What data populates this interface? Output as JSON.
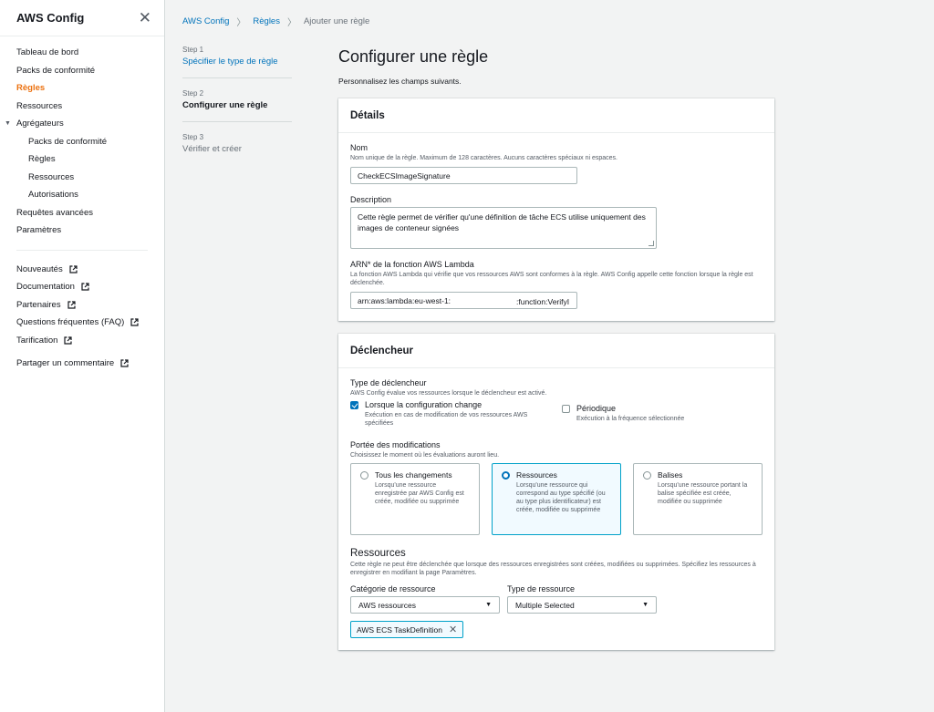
{
  "sidebar": {
    "title": "AWS Config",
    "close_icon": "✕",
    "items": [
      {
        "label": "Tableau de bord"
      },
      {
        "label": "Packs de conformité"
      },
      {
        "label": "Règles"
      },
      {
        "label": "Ressources"
      },
      {
        "label": "Agrégateurs"
      },
      {
        "label": "Packs de conformité"
      },
      {
        "label": "Règles"
      },
      {
        "label": "Ressources"
      },
      {
        "label": "Autorisations"
      },
      {
        "label": "Requêtes avancées"
      },
      {
        "label": "Paramètres"
      }
    ],
    "links": [
      {
        "label": "Nouveautés"
      },
      {
        "label": "Documentation"
      },
      {
        "label": "Partenaires"
      },
      {
        "label": "Questions fréquentes (FAQ)"
      },
      {
        "label": "Tarification"
      },
      {
        "label": "Partager un commentaire"
      }
    ]
  },
  "breadcrumb": {
    "items": [
      "AWS Config",
      "Règles",
      "Ajouter une règle"
    ]
  },
  "steps": [
    {
      "num": "Step 1",
      "label": "Spécifier le type de règle"
    },
    {
      "num": "Step 2",
      "label": "Configurer une règle"
    },
    {
      "num": "Step 3",
      "label": "Vérifier et créer"
    }
  ],
  "main": {
    "title": "Configurer une règle",
    "subtitle": "Personnalisez les champs suivants."
  },
  "details": {
    "header": "Détails",
    "name_label": "Nom",
    "name_desc": "Nom unique de la règle. Maximum de 128 caractères. Aucuns caractères spéciaux ni espaces.",
    "name_value": "CheckECSImageSignature",
    "desc_label": "Description",
    "desc_value": "Cette règle permet de vérifier qu'une définition de tâche ECS utilise uniquement des images de conteneur signées",
    "arn_label": "ARN* de la fonction AWS Lambda",
    "arn_desc": "La fonction AWS Lambda qui vérifie que vos ressources AWS sont conformes à la règle. AWS Config appelle cette fonction lorsque la règle est déclenchée.",
    "arn_prefix": "arn:aws:lambda:eu-west-1:",
    "arn_suffix": ":function:VerifyI"
  },
  "trigger": {
    "header": "Déclencheur",
    "type_label": "Type de déclencheur",
    "type_desc": "AWS Config évalue vos ressources lorsque le déclencheur est activé.",
    "opt_change_title": "Lorsque la configuration change",
    "opt_change_desc": "Exécution en cas de modification de vos ressources AWS spécifiées",
    "opt_periodic_title": "Périodique",
    "opt_periodic_desc": "Exécution à la fréquence sélectionnée",
    "scope_label": "Portée des modifications",
    "scope_desc": "Choisissez le moment où les évaluations auront lieu.",
    "tiles": [
      {
        "title": "Tous les changements",
        "desc": "Lorsqu'une ressource enregistrée par AWS Config est créée, modifiée ou supprimée"
      },
      {
        "title": "Ressources",
        "desc": "Lorsqu'une ressource qui correspond au type spécifié (ou au type plus identificateur) est créée, modifiée ou supprimée"
      },
      {
        "title": "Balises",
        "desc": "Lorsqu'une ressource portant la balise spécifiée est créée, modifiée ou supprimée"
      }
    ],
    "resources_title": "Ressources",
    "resources_desc": "Cette règle ne peut être déclenchée que lorsque des ressources enregistrées sont créées, modifiées ou supprimées. Spécifiez les ressources à enregistrer en modifiant la page Paramètres.",
    "category_label": "Catégorie de ressource",
    "category_value": "AWS ressources",
    "rtype_label": "Type de ressource",
    "rtype_value": "Multiple Selected",
    "token": "AWS ECS TaskDefinition"
  },
  "colors": {
    "accent": "#0073bb",
    "active_nav": "#ec7211",
    "tile_selected_border": "#00a1c9"
  }
}
